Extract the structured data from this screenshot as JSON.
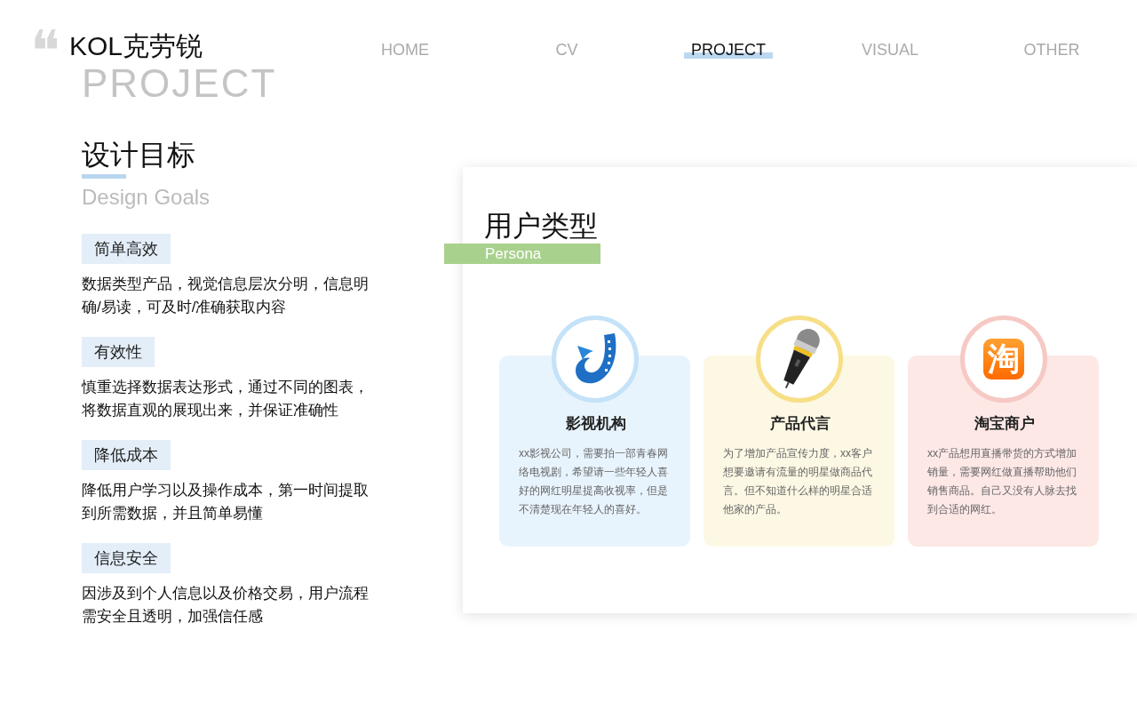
{
  "logo": {
    "quote_mark": "❝",
    "name": "KOL克劳锐",
    "backdrop_text": "PROJECT"
  },
  "nav": [
    {
      "label": "HOME",
      "selected": false
    },
    {
      "label": "CV",
      "selected": false
    },
    {
      "label": "PROJECT",
      "selected": true
    },
    {
      "label": "VISUAL",
      "selected": false
    },
    {
      "label": "OTHER",
      "selected": false
    }
  ],
  "design_goals": {
    "title": "设计目标",
    "subtitle": "Design Goals",
    "items": [
      {
        "tag": "简单高效",
        "text": "数据类型产品，视觉信息层次分明，信息明确/易读，可及时/准确获取内容"
      },
      {
        "tag": "有效性",
        "text": "慎重选择数据表达形式，通过不同的图表，将数据直观的展现出来，并保证准确性"
      },
      {
        "tag": "降低成本",
        "text": "降低用户学习以及操作成本，第一时间提取到所需数据，并且简单易懂"
      },
      {
        "tag": "信息安全",
        "text": "因涉及到个人信息以及价格交易，用户流程需安全且透明，加强信任感"
      }
    ]
  },
  "user_types": {
    "title": "用户类型",
    "label": "Persona",
    "cards": [
      {
        "kind": "film",
        "color": "#e8f4fd",
        "title": "影视机构",
        "text": "xx影视公司，需要拍一部青春网络电视剧，希望请一些年轻人喜好的网红明星提高收视率，但是不清楚现在年轻人的喜好。"
      },
      {
        "kind": "microphone",
        "color": "#fdf8e4",
        "title": "产品代言",
        "text": "为了增加产品宣传力度，xx客户想要邀请有流量的明星做商品代言。但不知道什么样的明星合适他家的产品。"
      },
      {
        "kind": "shop",
        "color": "#fde8e6",
        "glyph": "淘",
        "title": "淘宝商户",
        "text": "xx产品想用直播带货的方式增加销量，需要网红做直播帮助他们销售商品。自己又没有人脉去找到合适的网红。"
      }
    ]
  }
}
